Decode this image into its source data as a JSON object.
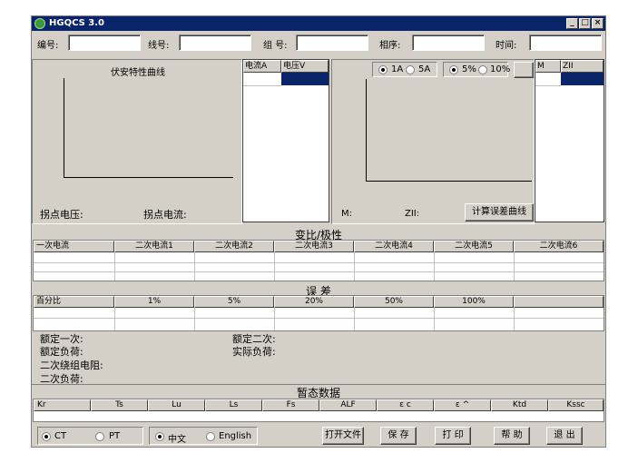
{
  "app": {
    "title": "HGQCS 3.0"
  },
  "fields": {
    "bianhao": "编号:",
    "xianhao": "线号:",
    "zuhao": "组 号:",
    "xiangxu": "相序:",
    "shijian": "时间:"
  },
  "curve": {
    "title": "伏安特性曲线",
    "knee_voltage": "拐点电压:",
    "knee_current": "拐点电流:"
  },
  "va_table": {
    "col1": "电流A",
    "col2": "电压V"
  },
  "err_panel": {
    "r1a": "1A",
    "r5a": "5A",
    "r5p": "5%",
    "r10p": "10%",
    "m_label": "M:",
    "z_label": "ZII:",
    "calc_button": "计算误差曲线"
  },
  "mz_table": {
    "col1": "M",
    "col2": "ZII"
  },
  "ratio": {
    "section": "变比/极性",
    "headers": [
      "一次电流",
      "二次电流1",
      "二次电流2",
      "二次电流3",
      "二次电流4",
      "二次电流5",
      "二次电流6"
    ]
  },
  "error": {
    "section": "误 差",
    "headers": [
      "百分比",
      "1%",
      "5%",
      "20%",
      "50%",
      "100%",
      ""
    ]
  },
  "info": {
    "rated_primary": "额定一次:",
    "rated_secondary": "额定二次:",
    "rated_burden": "额定负荷:",
    "actual_burden": "实际负荷:",
    "winding_resistance": "二次绕组电阻:",
    "secondary_burden": "二次负荷:"
  },
  "transient": {
    "section": "暂态数据",
    "headers": [
      "Kr",
      "Ts",
      "Lu",
      "Ls",
      "Fs",
      "ALF",
      "ε c",
      "ε ^",
      "Ktd",
      "Kssc"
    ]
  },
  "bottom": {
    "ct": "CT",
    "pt": "PT",
    "chinese": "中文",
    "english": "English",
    "open_file": "打开文件",
    "save": "保 存",
    "print": "打 印",
    "help": "帮 助",
    "exit": "退 出"
  },
  "colors": {
    "selected_cell": "#0a246a",
    "title_bar": "#0a246a",
    "face": "#d4d0c8"
  }
}
